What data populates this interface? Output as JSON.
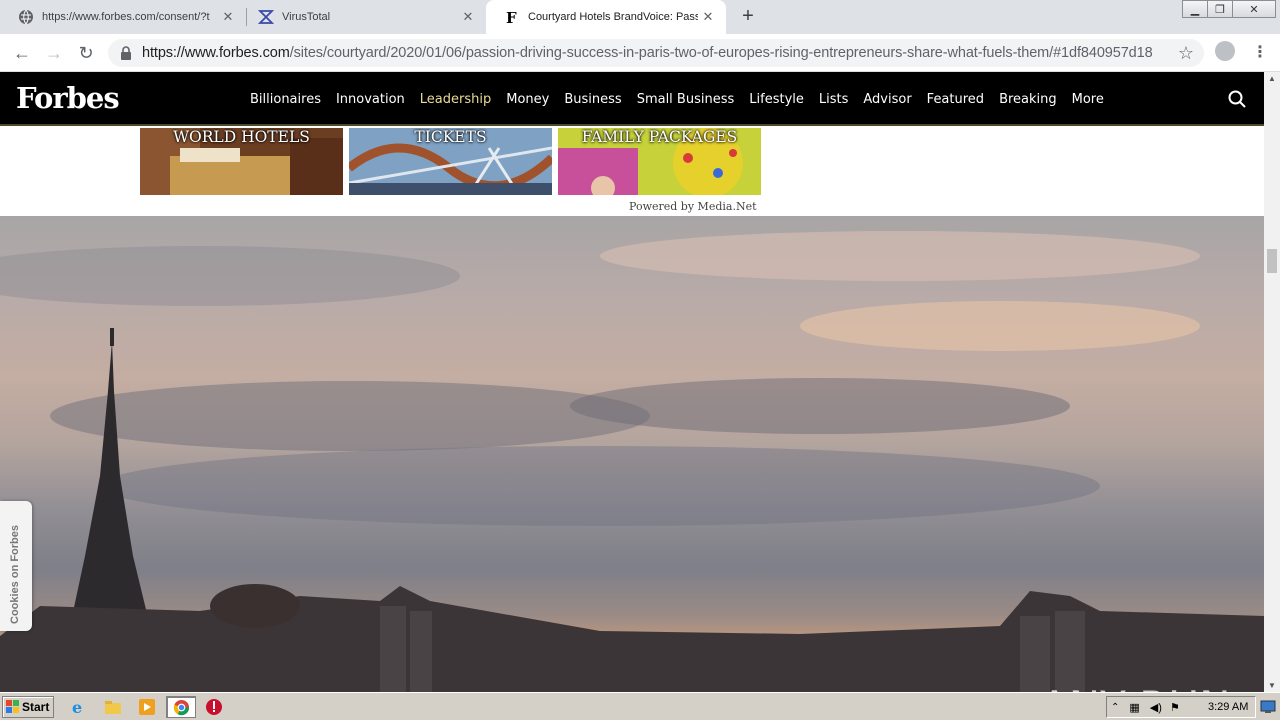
{
  "browser": {
    "tabs": [
      {
        "title": "https://www.forbes.com/consent/?t",
        "icon": "globe-icon",
        "active": false
      },
      {
        "title": "VirusTotal",
        "icon": "virustotal-icon",
        "active": false
      },
      {
        "title": "Courtyard Hotels BrandVoice: Passio",
        "icon": "forbes-f-icon",
        "active": true
      }
    ],
    "url_host": "https://www.forbes.com",
    "url_path": "/sites/courtyard/2020/01/06/passion-driving-success-in-paris-two-of-europes-rising-entrepreneurs-share-what-fuels-them/#1df840957d18"
  },
  "forbes": {
    "logo": "Forbes",
    "menu": [
      "Billionaires",
      "Innovation",
      "Leadership",
      "Money",
      "Business",
      "Small Business",
      "Lifestyle",
      "Lists",
      "Advisor",
      "Featured",
      "Breaking",
      "More"
    ],
    "active_menu": "Leadership"
  },
  "ads": {
    "items": [
      "WORLD HOTELS",
      "TICKETS",
      "FAMILY PACKAGES"
    ],
    "powered_by": "Powered by Media.Net"
  },
  "cookies_tab": "Cookies on Forbes",
  "watermark": "ANY RUN",
  "taskbar": {
    "start": "Start",
    "clock": "3:29 AM"
  },
  "colors": {
    "forbes_nav_bg": "#000000",
    "active_menu": "#eadb9a",
    "tab_strip": "#dee1e6"
  }
}
